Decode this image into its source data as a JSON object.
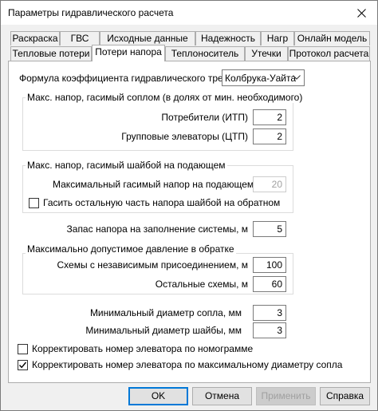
{
  "window": {
    "title": "Параметры гидравлического расчета",
    "close_glyph": "✕"
  },
  "tabs_row1": [
    {
      "label": "Раскраска"
    },
    {
      "label": "ГВС"
    },
    {
      "label": "Исходные данные"
    },
    {
      "label": "Надежность"
    },
    {
      "label": "Нагр"
    },
    {
      "label": "Онлайн модель"
    }
  ],
  "tabs_row2": [
    {
      "label": "Тепловые потери"
    },
    {
      "label": "Потери напора",
      "active": true
    },
    {
      "label": "Теплоноситель"
    },
    {
      "label": "Утечки"
    },
    {
      "label": "Протокол расчета"
    }
  ],
  "formula": {
    "label": "Формула коэффициента гидравлического трения",
    "value": "Колбрука-Уайта"
  },
  "group_nozzle": {
    "title": "Макс. напор, гасимый соплом (в долях от мин. необходимого)",
    "consumers_label": "Потребители (ИТП)",
    "consumers_value": "2",
    "elevators_label": "Групповые элеваторы (ЦТП)",
    "elevators_value": "2"
  },
  "group_washer": {
    "title": "Макс. напор, гасимый шайбой на подающем",
    "max_label": "Максимальный гасимый напор на подающем, м",
    "max_value": "20",
    "extinguish_label": "Гасить остальную часть напора шайбой на обратном",
    "extinguish_checked": false
  },
  "reserve": {
    "label": "Запас напора на заполнение системы, м",
    "value": "5"
  },
  "group_return": {
    "title": "Максимально допустимое давление в обратке",
    "independent_label": "Схемы с независимым присоединением, м",
    "independent_value": "100",
    "other_label": "Остальные схемы, м",
    "other_value": "60"
  },
  "min_nozzle": {
    "label": "Минимальный диаметр сопла, мм",
    "value": "3"
  },
  "min_washer": {
    "label": "Минимальный диаметр шайбы, мм",
    "value": "3"
  },
  "nomogram": {
    "label": "Корректировать номер элеватора по номограмме",
    "checked": false
  },
  "maxdiam": {
    "label": "Корректировать номер элеватора по максимальному диаметру сопла",
    "checked": true
  },
  "buttons": {
    "ok": "OK",
    "cancel": "Отмена",
    "apply": "Применить",
    "help": "Справка"
  },
  "icons": {
    "close": "close-icon",
    "dropdown": "chevron-down-icon",
    "check": "checkmark-icon"
  }
}
